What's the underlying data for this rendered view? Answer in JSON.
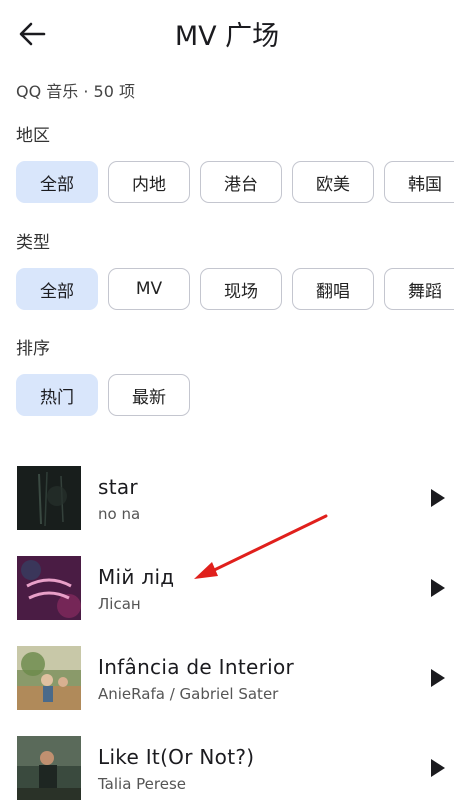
{
  "header": {
    "title": "MV 广场",
    "back_icon": "arrow-left-icon"
  },
  "subtitle": "QQ 音乐 · 50 项",
  "filters": {
    "region": {
      "label": "地区",
      "chips": [
        "全部",
        "内地",
        "港台",
        "欧美",
        "韩国"
      ],
      "selected": "全部"
    },
    "type": {
      "label": "类型",
      "chips": [
        "全部",
        "MV",
        "现场",
        "翻唱",
        "舞蹈"
      ],
      "selected": "全部"
    },
    "sort": {
      "label": "排序",
      "chips": [
        "热门",
        "最新"
      ],
      "selected": "热门"
    }
  },
  "mv_list": [
    {
      "title": "star",
      "artist": "no na",
      "icon": "play-icon"
    },
    {
      "title": "Мій лід",
      "artist": "Лісан",
      "icon": "play-icon"
    },
    {
      "title": "Infância de Interior",
      "artist": "AnieRafa / Gabriel Sater",
      "icon": "play-icon"
    },
    {
      "title": "Like It(Or Not?)",
      "artist": "Talia Perese",
      "icon": "play-icon"
    }
  ],
  "colors": {
    "selected_chip": "#d9e6fb",
    "annotation_arrow": "#e0201c"
  }
}
